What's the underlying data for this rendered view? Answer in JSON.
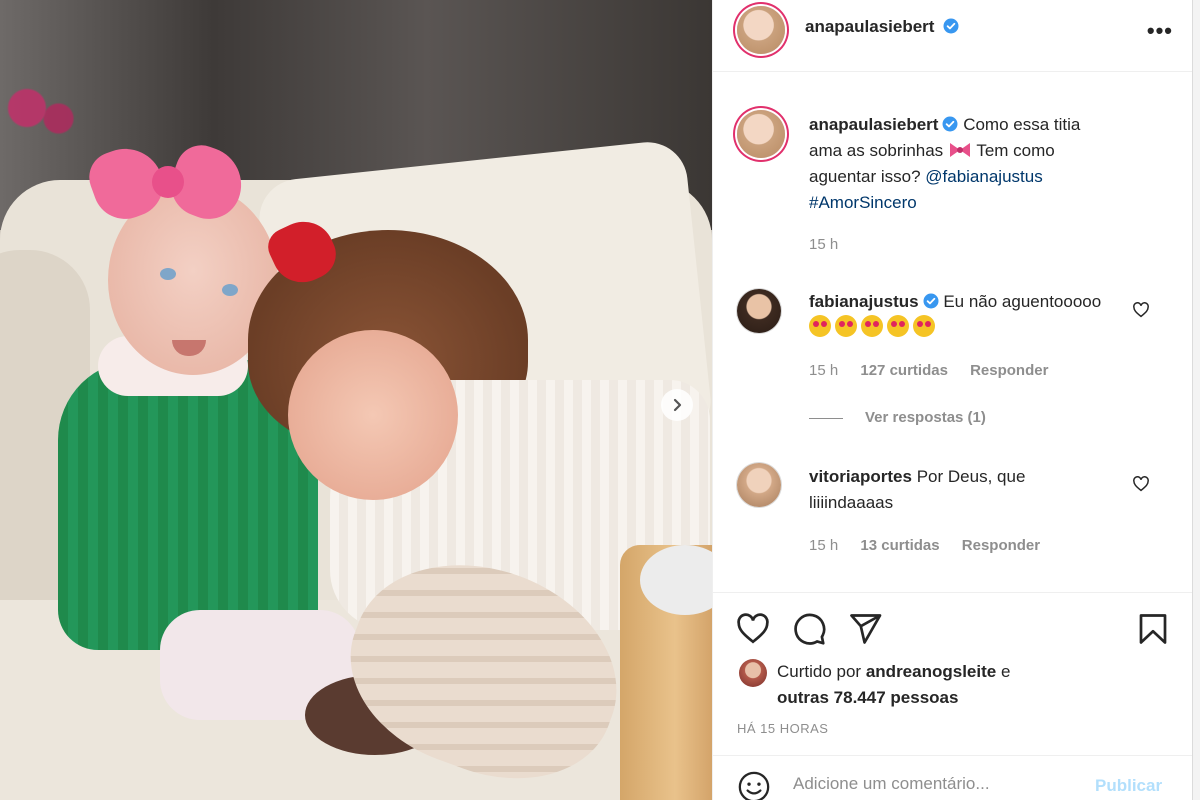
{
  "post": {
    "author": "anapaulasiebert",
    "more_icon": "•••",
    "caption_prefix": "Como essa titia ama as sobrinhas",
    "caption_suffix": "Tem como aguentar isso?",
    "caption_mention": "@fabianajustus",
    "caption_hashtag": "#AmorSincero",
    "caption_time": "15 h"
  },
  "comments": [
    {
      "user": "fabianajustus",
      "verified": true,
      "text": "Eu não aguentooooo",
      "emoji_count": 5,
      "time": "15 h",
      "likes": "127 curtidas",
      "reply": "Responder",
      "view_replies": "Ver respostas (1)"
    },
    {
      "user": "vitoriaportes",
      "verified": false,
      "text": "Por Deus, que liiiindaaaas",
      "time": "15 h",
      "likes": "13 curtidas",
      "reply": "Responder"
    }
  ],
  "engagement": {
    "liked_by_prefix": "Curtido por",
    "liked_by_user": "andreanogsleite",
    "liked_by_connector": "e",
    "liked_by_others": "outras 78.447 pessoas",
    "date": "HÁ 15 HORAS"
  },
  "composer": {
    "placeholder": "Adicione um comentário...",
    "publish_label": "Publicar"
  },
  "colors": {
    "accent": "#0095f6",
    "verified": "#3897f0",
    "story_ring": "#e1306c",
    "link": "#00376b"
  },
  "icons": [
    "chevron-right-icon",
    "verified-icon",
    "more-icon",
    "heart-icon",
    "comment-icon",
    "share-icon",
    "bookmark-icon",
    "emoji-icon"
  ]
}
